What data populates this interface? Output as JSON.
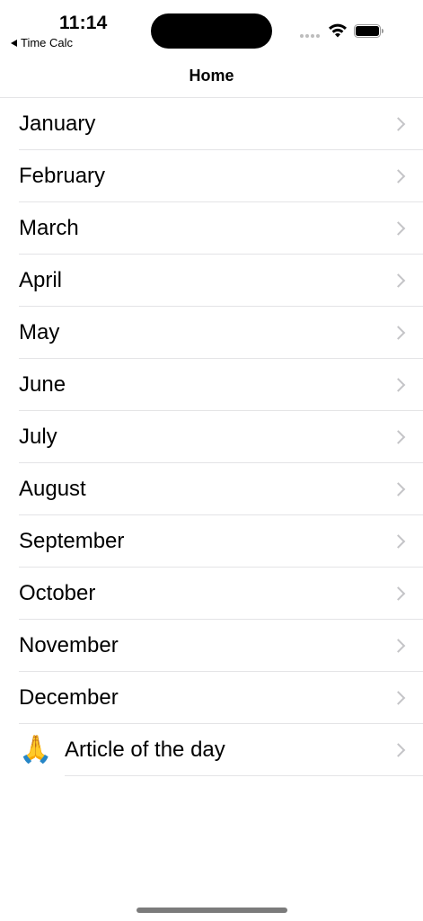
{
  "status_bar": {
    "time": "11:14",
    "back_app_label": "Time Calc",
    "icons": [
      "signal-dots-icon",
      "wifi-icon",
      "battery-icon"
    ]
  },
  "nav": {
    "title": "Home"
  },
  "months": [
    {
      "label": "January"
    },
    {
      "label": "February"
    },
    {
      "label": "March"
    },
    {
      "label": "April"
    },
    {
      "label": "May"
    },
    {
      "label": "June"
    },
    {
      "label": "July"
    },
    {
      "label": "August"
    },
    {
      "label": "September"
    },
    {
      "label": "October"
    },
    {
      "label": "November"
    },
    {
      "label": "December"
    }
  ],
  "article": {
    "emoji": "🙏",
    "label": "Article of the day"
  },
  "colors": {
    "separator": "#e4e4e6",
    "chevron": "#c4c4c7",
    "home_indicator": "#7b7b7b"
  }
}
